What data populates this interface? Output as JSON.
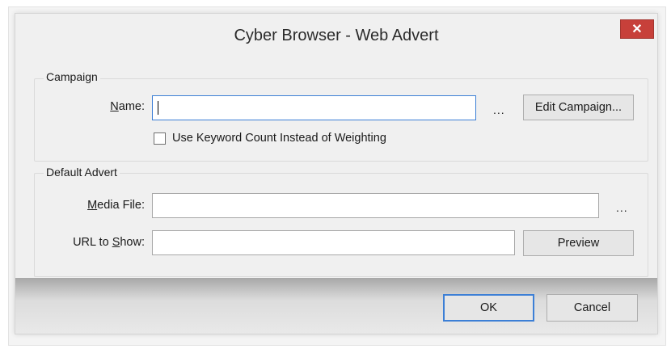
{
  "window": {
    "title": "Cyber Browser - Web Advert",
    "close_glyph": "✕"
  },
  "campaign_group": {
    "legend": "Campaign",
    "name_label_mnemonic": "N",
    "name_label_rest": "ame:",
    "name_value": "",
    "browse_label": "...",
    "edit_button_label": "Edit Campaign...",
    "keyword_checkbox_label": "Use Keyword Count Instead of Weighting",
    "keyword_checked": false
  },
  "default_advert_group": {
    "legend": "Default Advert",
    "media_label_mnemonic": "M",
    "media_label_rest": "edia File:",
    "media_value": "",
    "media_browse_label": "...",
    "url_label_pre": "URL to ",
    "url_label_mnemonic": "S",
    "url_label_rest": "how:",
    "url_value": "",
    "preview_button_label": "Preview"
  },
  "footer": {
    "ok_label": "OK",
    "cancel_label": "Cancel"
  },
  "colors": {
    "close_button": "#c7403a",
    "focus_accent": "#3c7fd6"
  },
  "icons": {
    "close": "close-icon"
  }
}
